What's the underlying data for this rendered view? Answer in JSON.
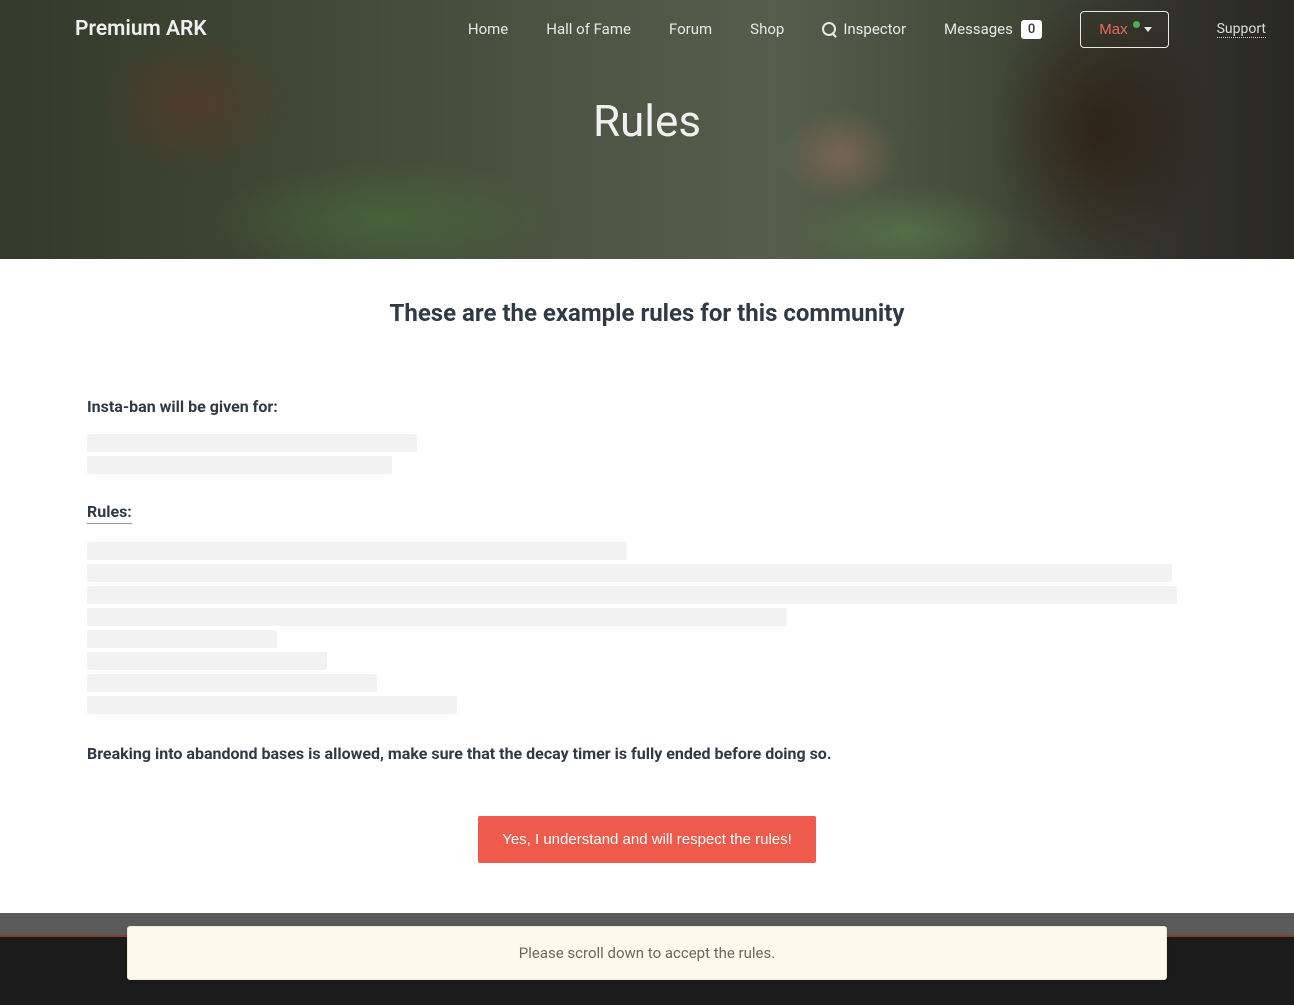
{
  "brand": "Premium ARK",
  "nav": {
    "home": "Home",
    "hall_of_fame": "Hall of Fame",
    "forum": "Forum",
    "shop": "Shop",
    "inspector": "Inspector",
    "messages": "Messages",
    "messages_count": "0",
    "user_name": "Max",
    "support": "Support"
  },
  "hero_title": "Rules",
  "subtitle": "These are the example rules for this community",
  "sections": {
    "instaban_heading": "Insta-ban will be given for:",
    "rules_heading": "Rules:",
    "abandoned_text": "Breaking into abandond bases is allowed, make sure that the decay timer is fully ended before doing so."
  },
  "accept_button": "Yes, I understand and will respect the rules!",
  "toast": "Please scroll down to accept the rules."
}
